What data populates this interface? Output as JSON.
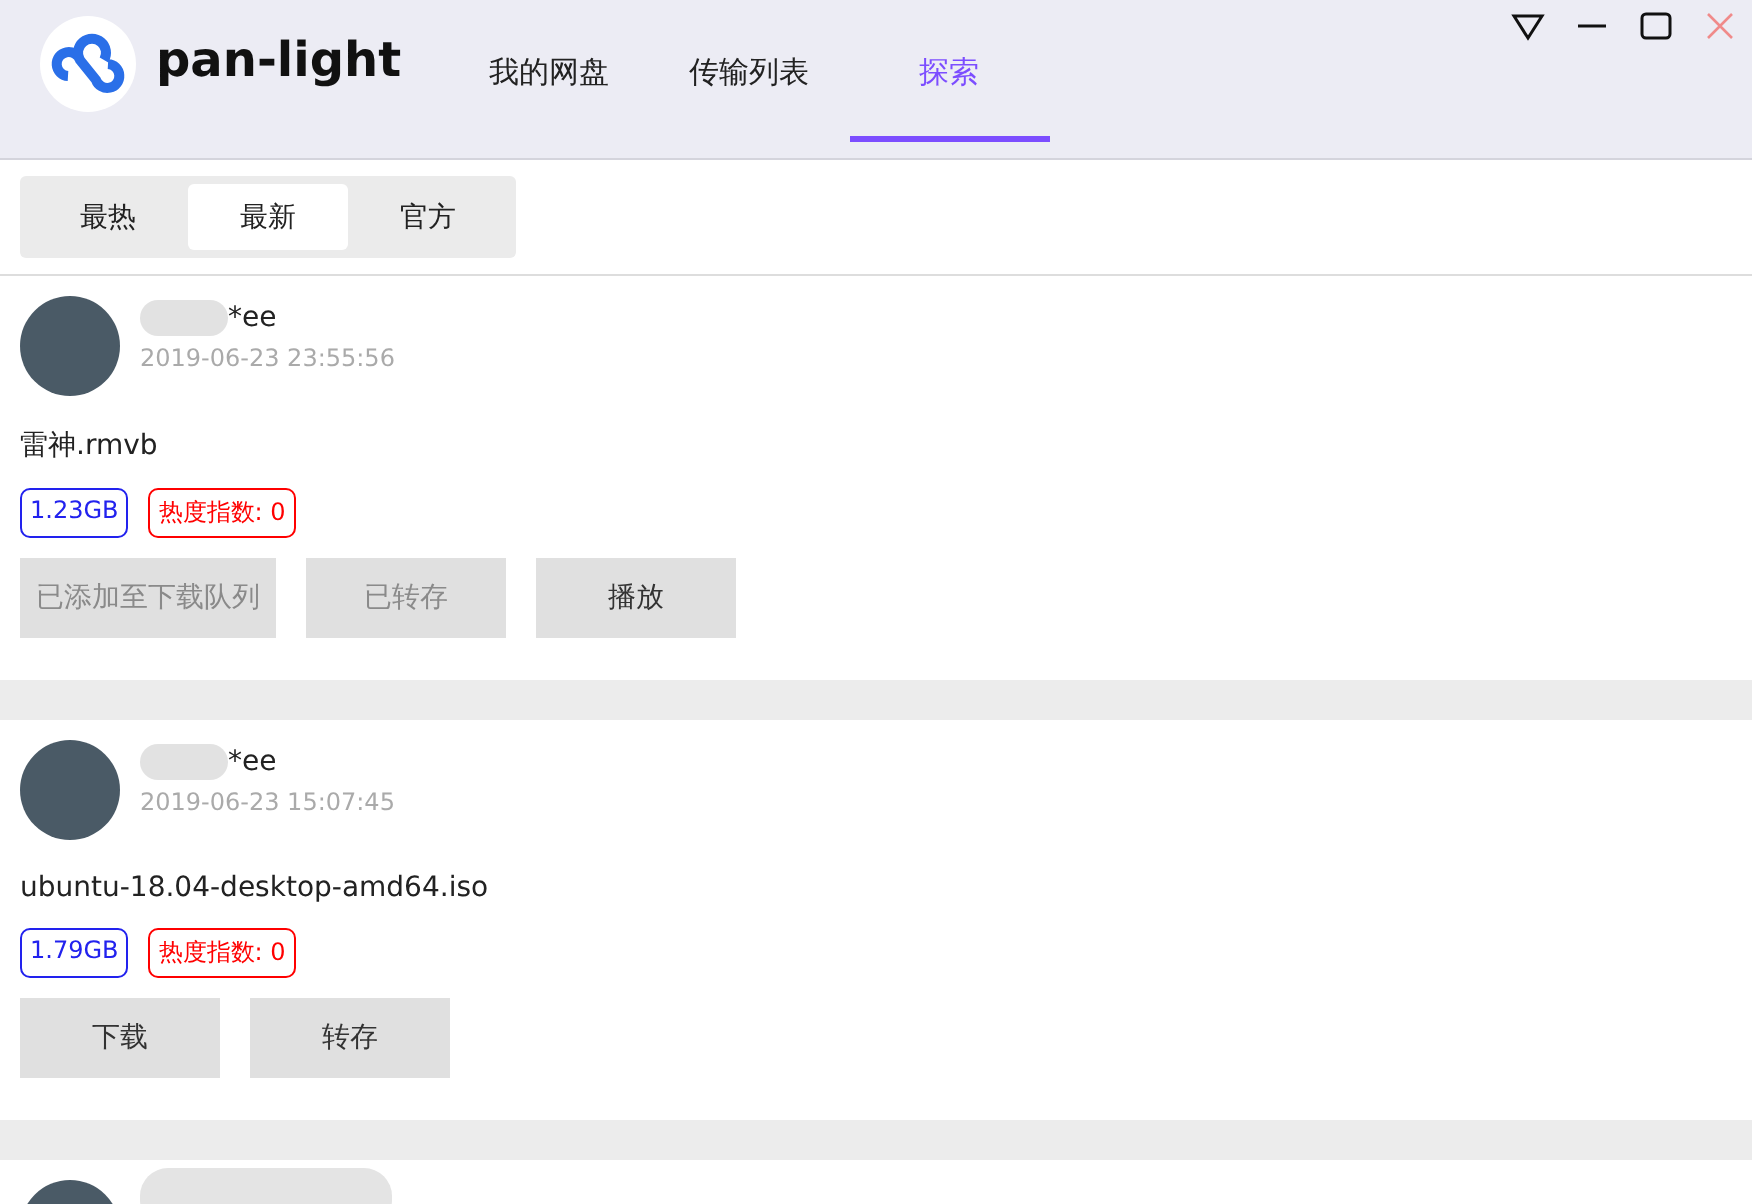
{
  "app": {
    "title": "pan-light"
  },
  "tabs": [
    {
      "label": "我的网盘",
      "selected": false
    },
    {
      "label": "传输列表",
      "selected": false
    },
    {
      "label": "探索",
      "selected": true
    }
  ],
  "sub_tabs": [
    {
      "label": "最热",
      "selected": false
    },
    {
      "label": "最新",
      "selected": true
    },
    {
      "label": "官方",
      "selected": false
    }
  ],
  "posts": [
    {
      "username": "*ee",
      "time": "2019-06-23 23:55:56",
      "filename": "雷神.rmvb",
      "size": "1.23GB",
      "heat": "热度指数: 0",
      "buttons": [
        {
          "label": "已添加至下载队列",
          "disabled": true
        },
        {
          "label": "已转存",
          "disabled": true
        },
        {
          "label": "播放",
          "disabled": false
        }
      ]
    },
    {
      "username": "*ee",
      "time": "2019-06-23 15:07:45",
      "filename": "ubuntu-18.04-desktop-amd64.iso",
      "size": "1.79GB",
      "heat": "热度指数: 0",
      "buttons": [
        {
          "label": "下载",
          "disabled": false
        },
        {
          "label": "转存",
          "disabled": false
        }
      ]
    }
  ]
}
